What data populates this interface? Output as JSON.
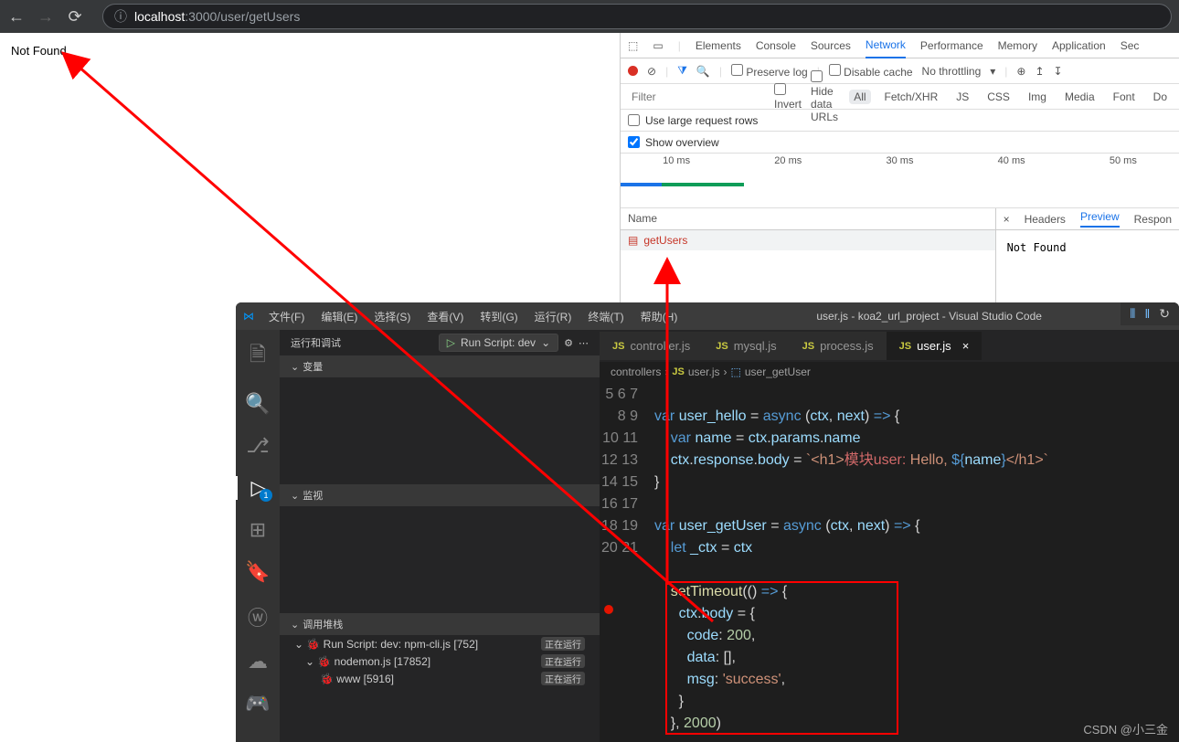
{
  "browser": {
    "url_prefix": "ⓘ",
    "url_host": "localhost",
    "url_path": ":3000/user/getUsers",
    "page_text": "Not Found"
  },
  "devtools": {
    "tabs": [
      "Elements",
      "Console",
      "Sources",
      "Network",
      "Performance",
      "Memory",
      "Application",
      "Sec"
    ],
    "active_tab": "Network",
    "preserve_log": "Preserve log",
    "disable_cache": "Disable cache",
    "throttling": "No throttling",
    "filter_placeholder": "Filter",
    "invert": "Invert",
    "hide_data_urls": "Hide data URLs",
    "filter_types": [
      "All",
      "Fetch/XHR",
      "JS",
      "CSS",
      "Img",
      "Media",
      "Font",
      "Do"
    ],
    "use_large_rows": "Use large request rows",
    "show_overview": "Show overview",
    "timeline": [
      "10 ms",
      "20 ms",
      "30 ms",
      "40 ms",
      "50 ms"
    ],
    "name_header": "Name",
    "request_name": "getUsers",
    "detail_tabs": [
      "Headers",
      "Preview",
      "Respon"
    ],
    "preview_text": "Not Found"
  },
  "vscode": {
    "menus": [
      "文件(F)",
      "编辑(E)",
      "选择(S)",
      "查看(V)",
      "转到(G)",
      "运行(R)",
      "终端(T)",
      "帮助(H)"
    ],
    "title": "user.js - koa2_url_project - Visual Studio Code",
    "sidebar": {
      "title": "运行和调试",
      "run_config": "Run Script: dev",
      "sections": {
        "vars": "变量",
        "watch": "监视",
        "callstack": "调用堆栈"
      },
      "callstack": [
        {
          "label": "Run Script: dev: npm-cli.js [752]",
          "status": "正在运行"
        },
        {
          "label": "nodemon.js [17852]",
          "status": "正在运行"
        },
        {
          "label": "www [5916]",
          "status": "正在运行"
        }
      ]
    },
    "tabs": [
      {
        "label": "controller.js"
      },
      {
        "label": "mysql.js"
      },
      {
        "label": "process.js"
      },
      {
        "label": "user.js",
        "active": true
      }
    ],
    "breadcrumb": [
      "controllers",
      "user.js",
      "user_getUser"
    ],
    "activity_badge": "1",
    "code_lines": [
      "5",
      "6",
      "7",
      "8",
      "9",
      "10",
      "11",
      "12",
      "13",
      "14",
      "15",
      "16",
      "17",
      "18",
      "19",
      "20",
      "21"
    ]
  },
  "watermark": "CSDN @小三金"
}
